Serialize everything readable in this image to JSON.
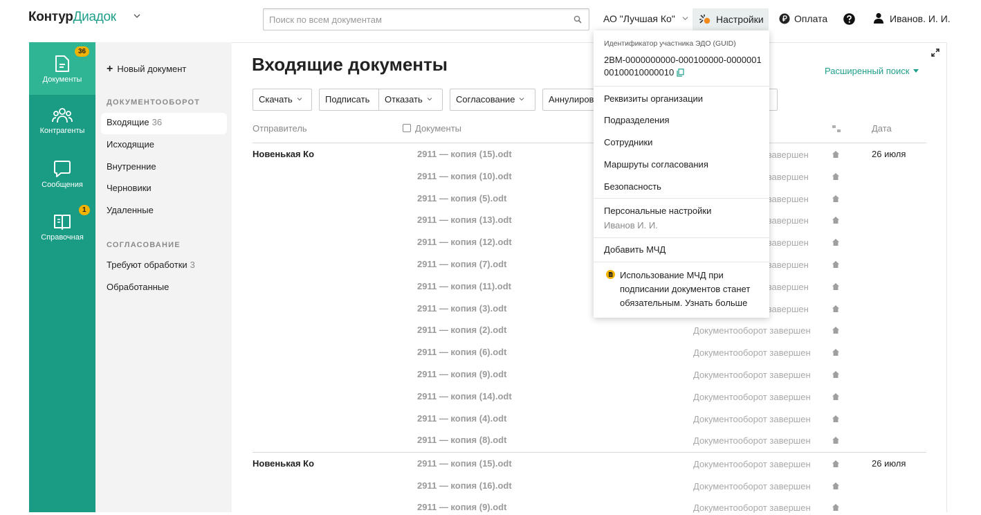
{
  "header": {
    "logo_brand": "Контур",
    "logo_product": "Диадок",
    "search_placeholder": "Поиск по всем документам",
    "org_name": "АО \"Лучшая Ко\"",
    "settings_label": "Настройки",
    "pay_label": "Оплата",
    "user_name": "Иванов. И. И."
  },
  "leftnav": {
    "items": [
      {
        "label": "Документы",
        "badge": "36",
        "icon": "document-icon"
      },
      {
        "label": "Контрагенты",
        "badge": "",
        "icon": "people-icon"
      },
      {
        "label": "Сообщения",
        "badge": "",
        "icon": "chat-icon"
      },
      {
        "label": "Справочная",
        "badge": "1",
        "icon": "book-icon"
      }
    ],
    "active_color": "#2fb594",
    "bg_color": "#1a9c84"
  },
  "sidebar": {
    "new_doc": "Новый документ",
    "section1": "ДОКУМЕНТООБОРОТ",
    "items1": [
      {
        "label": "Входящие",
        "count": "36"
      },
      {
        "label": "Исходящие",
        "count": ""
      },
      {
        "label": "Внутренние",
        "count": ""
      },
      {
        "label": "Черновики",
        "count": ""
      },
      {
        "label": "Удаленные",
        "count": ""
      }
    ],
    "section2": "СОГЛАСОВАНИЕ",
    "items2": [
      {
        "label": "Требуют обработки",
        "count": "3"
      },
      {
        "label": "Обработанные",
        "count": ""
      }
    ]
  },
  "main": {
    "title": "Входящие документы",
    "advanced_search": "Расширенный поиск",
    "toolbar": {
      "download": "Скачать",
      "sign": "Подписать",
      "reject": "Отказать",
      "approve": "Согласование",
      "annul": "Аннулиров"
    },
    "columns": {
      "sender": "Отправитель",
      "documents": "Документы",
      "date": "Дата"
    },
    "groups": [
      {
        "sender": "Новенькая Ко",
        "date": "26 июля",
        "docs": [
          {
            "name": "2911 — копия (15).odt",
            "status": "т завершен"
          },
          {
            "name": "2911 — копия (10).odt",
            "status": "т завершен"
          },
          {
            "name": "2911 — копия (5).odt",
            "status": "т завершен"
          },
          {
            "name": "2911 — копия (13).odt",
            "status": "т завершен"
          },
          {
            "name": "2911 — копия (12).odt",
            "status": "т завершен"
          },
          {
            "name": "2911 — копия (7).odt",
            "status": "т завершен"
          },
          {
            "name": "2911 — копия (11).odt",
            "status": "т завершен"
          },
          {
            "name": "2911 — копия (3).odt",
            "status": "т завершен"
          },
          {
            "name": "2911 — копия (2).odt",
            "status": "Документооборот завершен"
          },
          {
            "name": "2911 — копия (6).odt",
            "status": "Документооборот завершен"
          },
          {
            "name": "2911 — копия (9).odt",
            "status": "Документооборот завершен"
          },
          {
            "name": "2911 — копия (14).odt",
            "status": "Документооборот завершен"
          },
          {
            "name": "2911 — копия (4).odt",
            "status": "Документооборот завершен"
          },
          {
            "name": "2911 — копия (8).odt",
            "status": "Документооборот завершен"
          }
        ]
      },
      {
        "sender": "Новенькая Ко",
        "date": "26 июля",
        "docs": [
          {
            "name": "2911 — копия (15).odt",
            "status": "Документооборот завершен"
          },
          {
            "name": "2911 — копия (16).odt",
            "status": "Документооборот завершен"
          },
          {
            "name": "2911 — копия (9).odt",
            "status": "Документооборот завершен"
          }
        ]
      }
    ]
  },
  "popup": {
    "guid_label": "Идентификатор участника ЭДО (GUID)",
    "guid_value": "2BM-0000000000-000100000-000000100100010000010",
    "items": [
      "Реквизиты организации",
      "Подразделения",
      "Сотрудники",
      "Маршруты согласования",
      "Безопасность"
    ],
    "personal": "Персональные настройки",
    "personal_sub": "Иванов И. И.",
    "add_mchd": "Добавить МЧД",
    "notice": "Использование МЧД при подписании документов станет обязательным. Узнать больше"
  }
}
